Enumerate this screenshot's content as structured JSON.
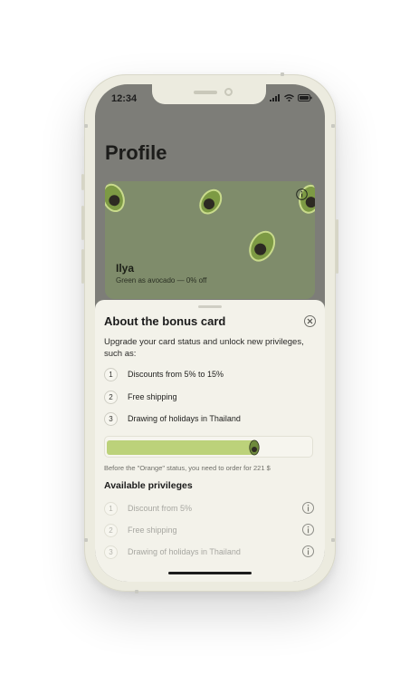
{
  "status_bar": {
    "time": "12:34"
  },
  "page": {
    "title": "Profile"
  },
  "card": {
    "name": "Ilya",
    "status": "Green as avocado — 0% off"
  },
  "sheet": {
    "title": "About the bonus card",
    "description": "Upgrade your card status and unlock new privileges, such as:",
    "benefits": [
      {
        "number": "1",
        "text": "Discounts from 5% to 15%"
      },
      {
        "number": "2",
        "text": "Free shipping"
      },
      {
        "number": "3",
        "text": "Drawing of holidays in Thailand"
      }
    ],
    "progress": {
      "fraction": 0.74,
      "note": "Before the \"Orange\" status, you need to order for 221 $"
    },
    "available": {
      "title": "Available privileges",
      "items": [
        {
          "number": "1",
          "text": "Discount from 5%"
        },
        {
          "number": "2",
          "text": "Free shipping"
        },
        {
          "number": "3",
          "text": "Drawing of holidays in Thailand"
        }
      ]
    }
  },
  "icons": {
    "signal": "cellular-signal-icon",
    "wifi": "wifi-icon",
    "battery": "battery-icon",
    "card_info": "info-icon",
    "close": "close-icon",
    "privilege_info": "info-icon",
    "mascot": "avocado-icon"
  },
  "colors": {
    "sheet_background": "#f3f2ea",
    "card_green": "#7f8c6b",
    "progress_fill": "#bcd27a",
    "avocado_skin": "#6e8a3c",
    "avocado_flesh": "#bcd27a"
  }
}
